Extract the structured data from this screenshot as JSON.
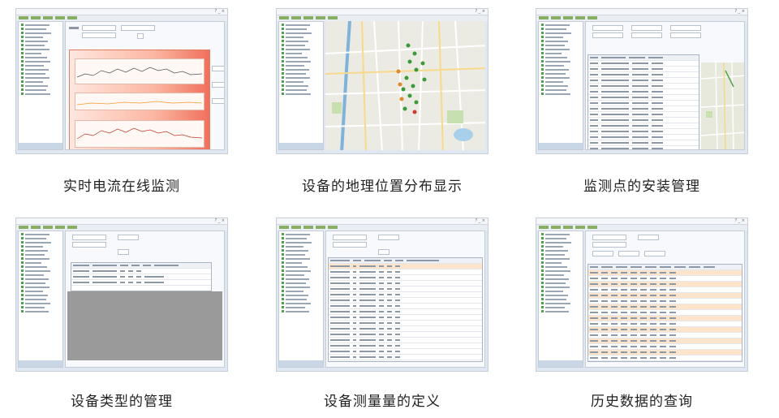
{
  "captions": [
    "实时电流在线监测",
    "设备的地理位置分布显示",
    "监测点的安装管理",
    "设备类型的管理",
    "设备测量量的定义",
    "历史数据的查询"
  ],
  "colors": {
    "window_bg": "#dfe7f2",
    "tree_icon": "#4fa04a",
    "chart_gradient_end": "#f0705c",
    "highlight_row": "#fde4cb",
    "grey_area": "#9a9a9a"
  }
}
